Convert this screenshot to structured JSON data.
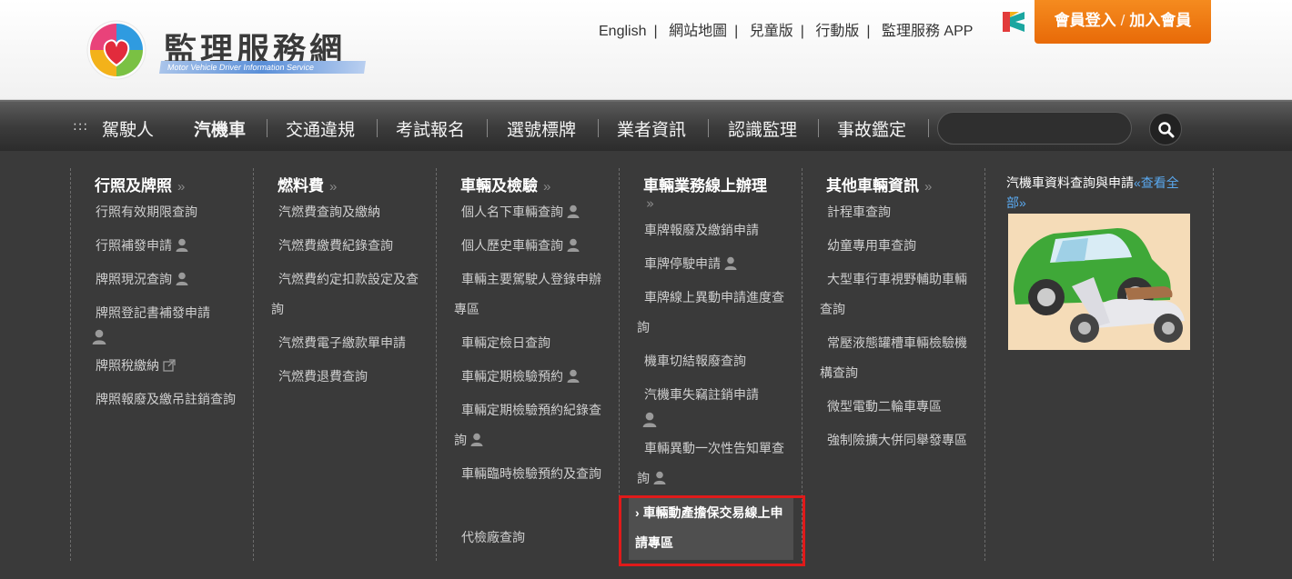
{
  "header": {
    "logo_title": "監理服務網",
    "logo_subtitle": "Motor Vehicle Driver Information Service",
    "top_links": [
      "English",
      "網站地圖",
      "兒童版",
      "行動版",
      "監理服務 APP"
    ],
    "member_login": "會員登入",
    "member_join": "加入會員"
  },
  "nav": {
    "items": [
      "駕駛人",
      "汽機車",
      "交通違規",
      "考試報名",
      "選號標牌",
      "業者資訊",
      "認識監理",
      "事故鑑定"
    ],
    "active": "汽機車",
    "search_placeholder": ""
  },
  "menu": {
    "columns": [
      {
        "title": "行照及牌照",
        "items": [
          "行照有效期限查詢",
          "行照補發申請",
          "牌照現況查詢",
          "牌照登記書補發申請",
          "牌照稅繳納",
          "牌照報廢及繳吊註銷查詢"
        ]
      },
      {
        "title": "燃料費",
        "items": [
          "汽燃費查詢及繳納",
          "汽燃費繳費紀錄查詢",
          "汽燃費約定扣款設定及查詢",
          "汽燃費電子繳款單申請",
          "汽燃費退費查詢"
        ]
      },
      {
        "title": "車輛及檢驗",
        "items": [
          "個人名下車輛查詢",
          "個人歷史車輛查詢",
          "車輛主要駕駛人登錄申辦專區",
          "車輛定檢日查詢",
          "車輛定期檢驗預約",
          "車輛定期檢驗預約紀錄查詢",
          "車輛臨時檢驗預約及查詢",
          "代檢廠查詢"
        ]
      },
      {
        "title": "車輛業務線上辦理",
        "items": [
          "車牌報廢及繳銷申請",
          "車牌停駛申請",
          "車牌線上異動申請進度查詢",
          "機車切結報廢查詢",
          "汽機車失竊註銷申請",
          "車輛異動一次性告知單查詢",
          "車輛動產擔保交易線上申請專區"
        ]
      },
      {
        "title": "其他車輛資訊",
        "items": [
          "計程車查詢",
          "幼童專用車查詢",
          "大型車行車視野輔助車輛查詢",
          "常壓液態罐槽車輛檢驗機構查詢",
          "微型電動二輪車專區",
          "強制險擴大併同舉發專區"
        ]
      }
    ],
    "side": {
      "title": "汽機車資料查詢與申請",
      "view_all": "«查看全部»"
    }
  },
  "colors": {
    "accent_orange": "#f07a12",
    "highlight_red": "#e01a1a",
    "link_blue": "#5aa9f0",
    "menu_bg": "#3a3a3a"
  }
}
